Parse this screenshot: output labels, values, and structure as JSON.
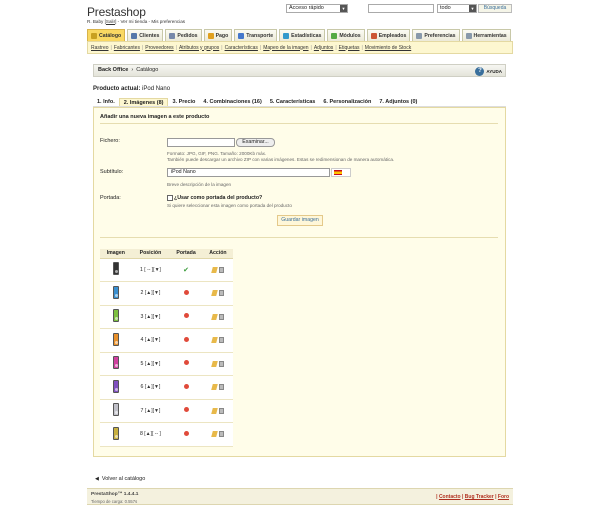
{
  "header": {
    "logo": "Prestashop",
    "user_line": {
      "name": "R. Baby",
      "logout": "Salir",
      "view_store": "Ver mi tienda",
      "preferences": "Mis preferencias"
    },
    "quick_access": "Acceso rápido",
    "search_scope": "todo",
    "search_button": "Búsqueda"
  },
  "tabs": [
    {
      "label": "Catálogo",
      "icon": "catalog-icon",
      "color": "#c8a020"
    },
    {
      "label": "Clientes",
      "icon": "customers-icon",
      "color": "#5577aa"
    },
    {
      "label": "Pedidos",
      "icon": "orders-icon",
      "color": "#7788aa"
    },
    {
      "label": "Pago",
      "icon": "payment-icon",
      "color": "#e0a020"
    },
    {
      "label": "Transporte",
      "icon": "shipping-icon",
      "color": "#4477cc"
    },
    {
      "label": "Estadísticas",
      "icon": "stats-icon",
      "color": "#3399cc"
    },
    {
      "label": "Módulos",
      "icon": "modules-icon",
      "color": "#55aa44"
    },
    {
      "label": "Empleados",
      "icon": "employees-icon",
      "color": "#cc5533"
    },
    {
      "label": "Preferencias",
      "icon": "preferences-icon",
      "color": "#8899aa"
    },
    {
      "label": "Herramientas",
      "icon": "tools-icon",
      "color": "#8899aa"
    }
  ],
  "subtabs": [
    "Rastreo",
    "Fabricantes",
    "Proveedores",
    "Atributos y grupos",
    "Características",
    "Mapeo de la imagen",
    "Adjuntos",
    "Etiquetas",
    "Movimiento de Stock"
  ],
  "breadcrumb": {
    "root": "Back Office",
    "current": "Catálogo",
    "help": "AYUDA"
  },
  "product": {
    "label": "Producto actual:",
    "name": "iPod Nano"
  },
  "product_tabs": [
    "1. Info.",
    "2. Imágenes (8)",
    "3. Precio",
    "4. Combinaciones (16)",
    "5. Características",
    "6. Personalización",
    "7. Adjuntos (0)"
  ],
  "form": {
    "title": "Añadir una nueva imagen a este producto",
    "file_label": "Fichero:",
    "browse": "Examinar...",
    "file_help1": "Formato: JPG, GIF, PNG. Tamaño: 2000Kb máx.",
    "file_help2": "También puede descargar un archivo ZIP con varias imágenes. Estas se redimensionan de manera automática.",
    "subtitle_label": "Subtítulo:",
    "subtitle_value": "iPod Nano",
    "subtitle_help": "Breve descripción de la imagen",
    "cover_label": "Portada:",
    "cover_check": "¿Usar como portada del producto?",
    "cover_help": "Si quiere seleccionar esta imagen como portada del producto",
    "save": "Guardar imagen"
  },
  "table": {
    "headers": [
      "Imagen",
      "Posición",
      "Portada",
      "Acción"
    ],
    "rows": [
      {
        "pos": "1",
        "arrows": "[ -- ][▼]",
        "cover": true,
        "color": "#333"
      },
      {
        "pos": "2",
        "arrows": "[▲][▼]",
        "cover": false,
        "color": "#3a8fd0"
      },
      {
        "pos": "3",
        "arrows": "[▲][▼]",
        "cover": false,
        "color": "#7cc040"
      },
      {
        "pos": "4",
        "arrows": "[▲][▼]",
        "cover": false,
        "color": "#e8902a"
      },
      {
        "pos": "5",
        "arrows": "[▲][▼]",
        "cover": false,
        "color": "#d040a0"
      },
      {
        "pos": "6",
        "arrows": "[▲][▼]",
        "cover": false,
        "color": "#8050c0"
      },
      {
        "pos": "7",
        "arrows": "[▲][▼]",
        "cover": false,
        "color": "#c0c0c8"
      },
      {
        "pos": "8",
        "arrows": "[▲][ -- ]",
        "cover": false,
        "color": "#c8b040"
      }
    ]
  },
  "back_link": "Volver al catálogo",
  "footer": {
    "version": "PrestaShop™ 1.4.4.1",
    "load_time": "Tiempo de carga: 0.557s",
    "links": [
      "Contacto",
      "Bug Tracker",
      "Foro"
    ]
  }
}
